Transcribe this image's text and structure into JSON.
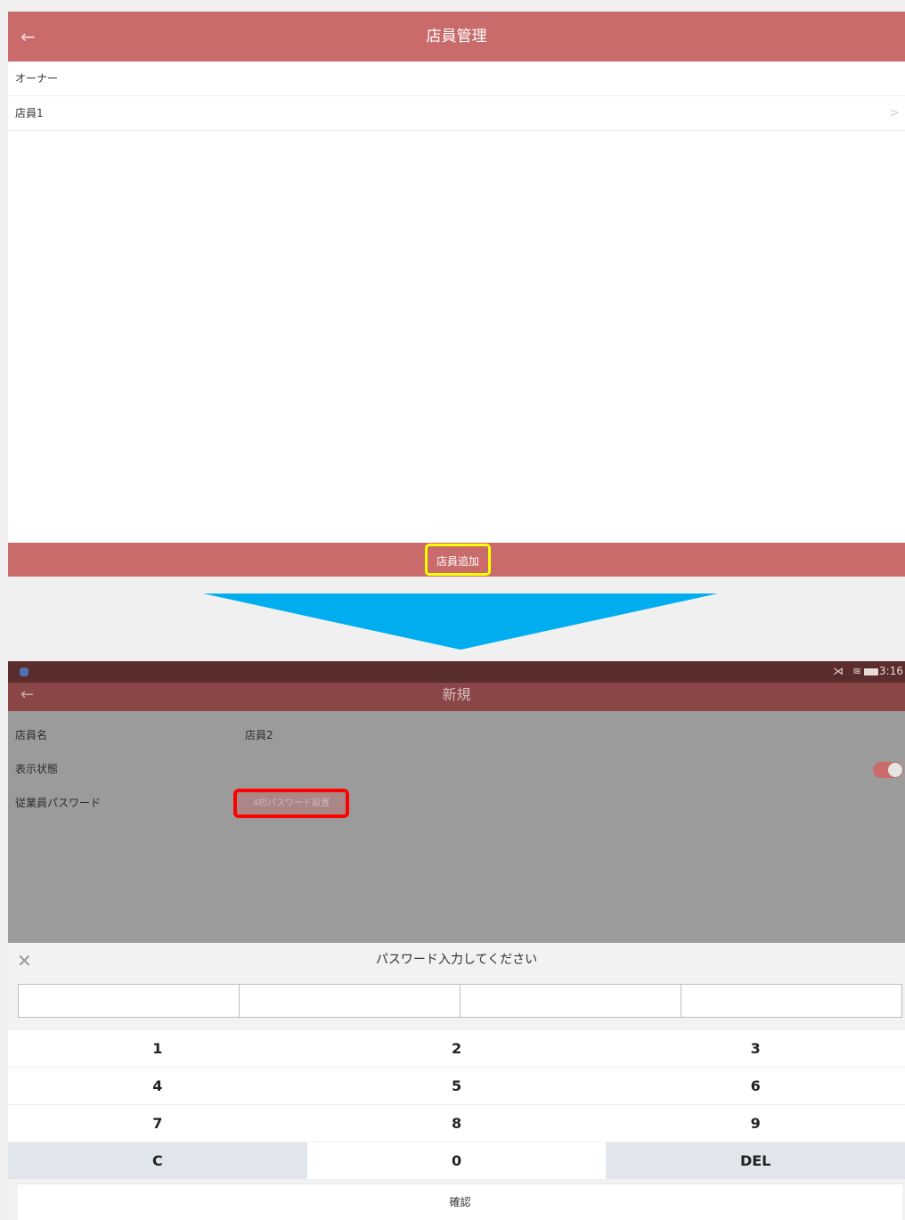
{
  "screen1": {
    "title": "店員管理",
    "back_icon": "←",
    "list": [
      {
        "label": "オーナー"
      },
      {
        "label": "店員1",
        "chevron": ">"
      }
    ],
    "add_button": "店員追加"
  },
  "arrow_color": "#00aeef",
  "screen2": {
    "status": {
      "time": "3:16",
      "icons": "⋊ ≋"
    },
    "title": "新規",
    "back_icon": "←",
    "rows": {
      "name_label": "店員名",
      "name_value": "店員2",
      "display_label": "表示状態",
      "display_on": true,
      "password_label": "従業員パスワード",
      "password_button": "4桁パスワード設置"
    },
    "dialog": {
      "close_icon": "✕",
      "title": "パスワード入力してください",
      "keys": [
        [
          "1",
          "2",
          "3"
        ],
        [
          "4",
          "5",
          "6"
        ],
        [
          "7",
          "8",
          "9"
        ],
        [
          "C",
          "0",
          "DEL"
        ]
      ],
      "confirm": "確認"
    }
  },
  "colors": {
    "brand": "#c96b6b",
    "highlight_yellow": "#ffff00",
    "highlight_red": "#ff0000"
  }
}
